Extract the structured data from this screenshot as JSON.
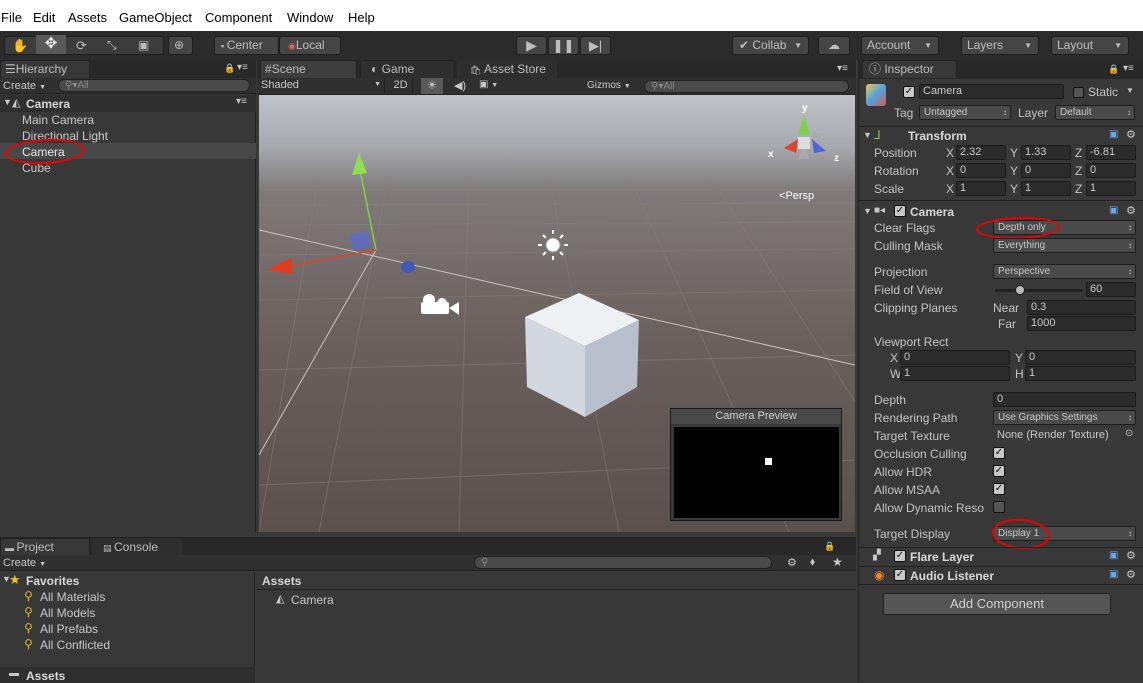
{
  "menu": [
    "File",
    "Edit",
    "Assets",
    "GameObject",
    "Component",
    "Window",
    "Help"
  ],
  "toolbar": {
    "center": "Center",
    "local": "Local",
    "collab": "Collab",
    "account": "Account",
    "layers": "Layers",
    "layout": "Layout"
  },
  "hierarchy": {
    "tab": "Hierarchy",
    "create": "Create",
    "search": "All",
    "scene": "Camera",
    "items": [
      "Main Camera",
      "Directional Light",
      "Camera",
      "Cube"
    ]
  },
  "scene": {
    "tabs": [
      "Scene",
      "Game",
      "Asset Store"
    ],
    "shade": "Shaded",
    "mode2d": "2D",
    "gizmos": "Gizmos",
    "search": "All",
    "persp": "Persp",
    "axis_y": "y",
    "axis_x": "x",
    "axis_z": "z",
    "preview_title": "Camera Preview"
  },
  "project": {
    "tabs": [
      "Project",
      "Console"
    ],
    "create": "Create",
    "favorites": "Favorites",
    "fav_items": [
      "All Materials",
      "All Models",
      "All Prefabs",
      "All Conflicted"
    ],
    "assets_root": "Assets",
    "assets_header": "Assets",
    "asset_items": [
      "Camera"
    ]
  },
  "inspector": {
    "tab": "Inspector",
    "name": "Camera",
    "static": "Static",
    "tag_label": "Tag",
    "tag": "Untagged",
    "layer_label": "Layer",
    "layer": "Default",
    "transform": {
      "title": "Transform",
      "position": {
        "label": "Position",
        "x": "2.32",
        "y": "1.33",
        "z": "-6.81"
      },
      "rotation": {
        "label": "Rotation",
        "x": "0",
        "y": "0",
        "z": "0"
      },
      "scale": {
        "label": "Scale",
        "x": "1",
        "y": "1",
        "z": "1"
      },
      "xl": "X",
      "yl": "Y",
      "zl": "Z"
    },
    "camera": {
      "title": "Camera",
      "clear_flags_label": "Clear Flags",
      "clear_flags": "Depth only",
      "culling_mask_label": "Culling Mask",
      "culling_mask": "Everything",
      "projection_label": "Projection",
      "projection": "Perspective",
      "fov_label": "Field of View",
      "fov": "60",
      "fov_fraction": 0.28,
      "clipping_label": "Clipping Planes",
      "near_label": "Near",
      "near": "0.3",
      "far_label": "Far",
      "far": "1000",
      "viewport_label": "Viewport Rect",
      "vx_label": "X",
      "vx": "0",
      "vy_label": "Y",
      "vy": "0",
      "vw_label": "W",
      "vw": "1",
      "vh_label": "H",
      "vh": "1",
      "depth_label": "Depth",
      "depth": "0",
      "render_path_label": "Rendering Path",
      "render_path": "Use Graphics Settings",
      "target_tex_label": "Target Texture",
      "target_tex": "None (Render Texture)",
      "occlusion_label": "Occlusion Culling",
      "hdr_label": "Allow HDR",
      "msaa_label": "Allow MSAA",
      "dynres_label": "Allow Dynamic Reso",
      "display_label": "Target Display",
      "display": "Display 1"
    },
    "flare": "Flare Layer",
    "audio": "Audio Listener",
    "add_component": "Add Component"
  }
}
